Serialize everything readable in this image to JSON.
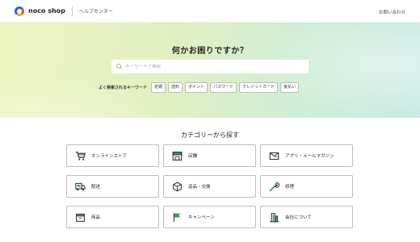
{
  "header": {
    "logo_text": "noco shop",
    "help_center": "ヘルプセンター",
    "contact": "お問い合わせ"
  },
  "hero": {
    "title": "何かお困りですか？",
    "search_placeholder": "キーワードで検索",
    "search_value": "",
    "keywords_label": "よく検索されるキーワード",
    "keywords": [
      "定期",
      "送料",
      "ポイント",
      "パスワード",
      "クレジットカード",
      "後払い"
    ]
  },
  "categories": {
    "title": "カテゴリーから探す",
    "items": [
      {
        "label": "オンラインストア",
        "icon": "cart-icon"
      },
      {
        "label": "店舗",
        "icon": "store-icon"
      },
      {
        "label": "アプリ・メールマガジン",
        "icon": "mail-icon"
      },
      {
        "label": "配送",
        "icon": "truck-icon"
      },
      {
        "label": "返品・交換",
        "icon": "box-icon"
      },
      {
        "label": "修理",
        "icon": "wrench-icon"
      },
      {
        "label": "商品",
        "icon": "product-icon"
      },
      {
        "label": "キャンペーン",
        "icon": "flag-icon"
      },
      {
        "label": "会社について",
        "icon": "building-icon"
      }
    ]
  },
  "colors": {
    "accent_green": "#3a9a5b",
    "icon_dark": "#333333"
  }
}
